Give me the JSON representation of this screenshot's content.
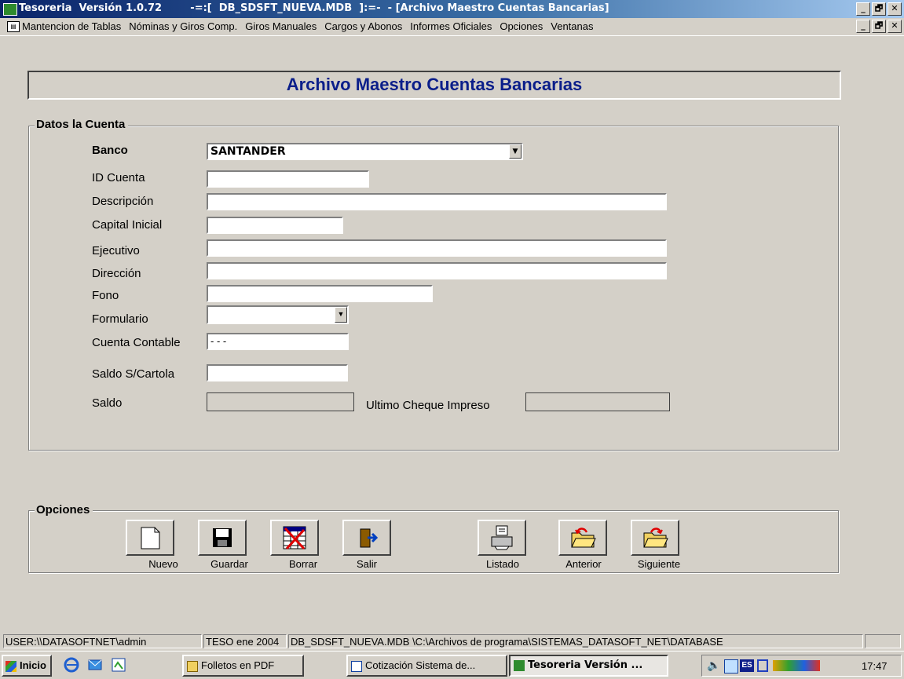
{
  "window": {
    "title": "Tesoreria  Versión 1.0.72        -=:[  DB_SDSFT_NUEVA.MDB  ]:=-  - [Archivo Maestro Cuentas Bancarias]",
    "controls": [
      "_",
      "🗗",
      "✕"
    ]
  },
  "menu": [
    "Mantencion de Tablas",
    "Nóminas y Giros Comp.",
    "Giros Manuales",
    "Cargos y Abonos",
    "Informes Oficiales",
    "Opciones",
    "Ventanas"
  ],
  "form": {
    "heading": "Archivo Maestro Cuentas Bancarias",
    "group_title": "Datos la Cuenta",
    "fields": {
      "banco": {
        "label": "Banco",
        "value": "SANTANDER"
      },
      "id_cuenta": {
        "label": "ID Cuenta",
        "value": ""
      },
      "descripcion": {
        "label": "Descripción",
        "value": ""
      },
      "capital_inicial": {
        "label": "Capital Inicial",
        "value": ""
      },
      "ejecutivo": {
        "label": "Ejecutivo",
        "value": ""
      },
      "direccion": {
        "label": "Dirección",
        "value": ""
      },
      "fono": {
        "label": "Fono",
        "value": ""
      },
      "formulario": {
        "label": "Formulario",
        "value": ""
      },
      "cuenta_contable": {
        "label": "Cuenta Contable",
        "value": "- - -"
      },
      "saldo_cartola": {
        "label": "Saldo S/Cartola",
        "value": ""
      },
      "saldo": {
        "label": "Saldo",
        "value": ""
      },
      "ultimo_cheque": {
        "label": "Ultimo Cheque Impreso",
        "value": ""
      }
    }
  },
  "options": {
    "group_title": "Opciones",
    "buttons": [
      "Nuevo",
      "Guardar",
      "Borrar",
      "Salir",
      "Listado",
      "Anterior",
      "Siguiente"
    ]
  },
  "statusbar": {
    "user": "USER:\\\\DATASOFTNET\\admin",
    "period": "TESO ene 2004",
    "db": "DB_SDSFT_NUEVA.MDB \\C:\\Archivos de programa\\SISTEMAS_DATASOFT_NET\\DATABASE"
  },
  "taskbar": {
    "start": "Inicio",
    "items": [
      "Folletos en PDF",
      "Cotización Sistema de...",
      "Tesoreria  Versión ..."
    ],
    "tray_lang": "ES",
    "clock": "17:47"
  },
  "colors": {
    "titlebar": "#0a246a",
    "heading": "#0a1e8a",
    "face": "#d4d0c8"
  }
}
